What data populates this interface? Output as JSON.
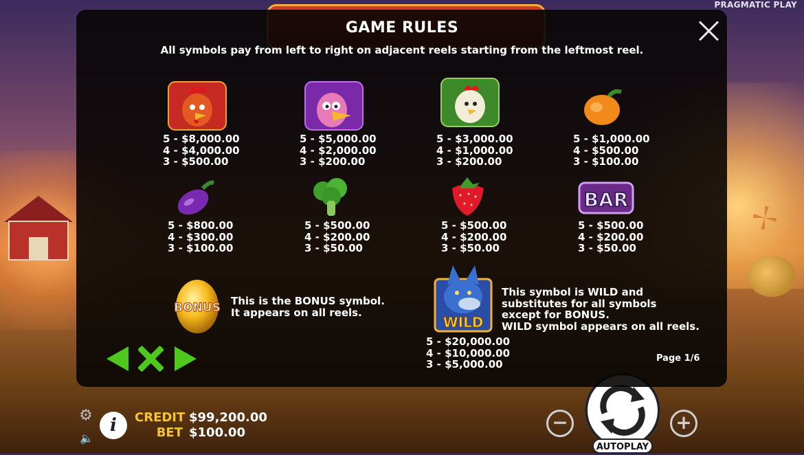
{
  "brand": "PRAGMATIC PLAY",
  "modal": {
    "title": "GAME RULES",
    "subtitle": "All symbols pay from left to right on adjacent reels starting from the leftmost reel.",
    "page": "Page 1/6"
  },
  "symbols": [
    {
      "icon": "red-rooster-icon",
      "pays": [
        "5 - $8,000.00",
        "4 - $4,000.00",
        "3 - $500.00"
      ]
    },
    {
      "icon": "pink-turkey-icon",
      "pays": [
        "5 - $5,000.00",
        "4 - $2,000.00",
        "3 - $200.00"
      ]
    },
    {
      "icon": "white-hen-icon",
      "pays": [
        "5 - $3,000.00",
        "4 - $1,000.00",
        "3 - $200.00"
      ]
    },
    {
      "icon": "pepper-icon",
      "pays": [
        "5 - $1,000.00",
        "4 - $500.00",
        "3 - $100.00"
      ]
    },
    {
      "icon": "eggplant-icon",
      "pays": [
        "5 - $800.00",
        "4 - $300.00",
        "3 - $100.00"
      ]
    },
    {
      "icon": "broccoli-icon",
      "pays": [
        "5 - $500.00",
        "4 - $200.00",
        "3 - $50.00"
      ]
    },
    {
      "icon": "strawberry-icon",
      "pays": [
        "5 - $500.00",
        "4 - $200.00",
        "3 - $50.00"
      ]
    },
    {
      "icon": "bar-icon",
      "icon_text": "BAR",
      "pays": [
        "5 - $500.00",
        "4 - $200.00",
        "3 - $50.00"
      ]
    }
  ],
  "bonus": {
    "icon": "golden-egg-bonus-icon",
    "icon_text": "BONUS",
    "text": [
      "This is the BONUS symbol.",
      "It appears on all reels."
    ]
  },
  "wild": {
    "icon": "wolf-wild-icon",
    "icon_text": "WILD",
    "text": [
      "This symbol is WILD and",
      "substitutes for all symbols",
      "except for BONUS.",
      "WILD symbol appears on all reels."
    ],
    "pays": [
      "5 - $20,000.00",
      "4 - $10,000.00",
      "3 - $5,000.00"
    ]
  },
  "footer": {
    "credit_label": "CREDIT",
    "credit_value": "$99,200.00",
    "bet_label": "BET",
    "bet_value": "$100.00",
    "autoplay_label": "AUTOPLAY",
    "minus_label": "−",
    "plus_label": "+"
  },
  "colors": {
    "accent_green": "#4fc81e",
    "label_gold": "#f5c430"
  }
}
